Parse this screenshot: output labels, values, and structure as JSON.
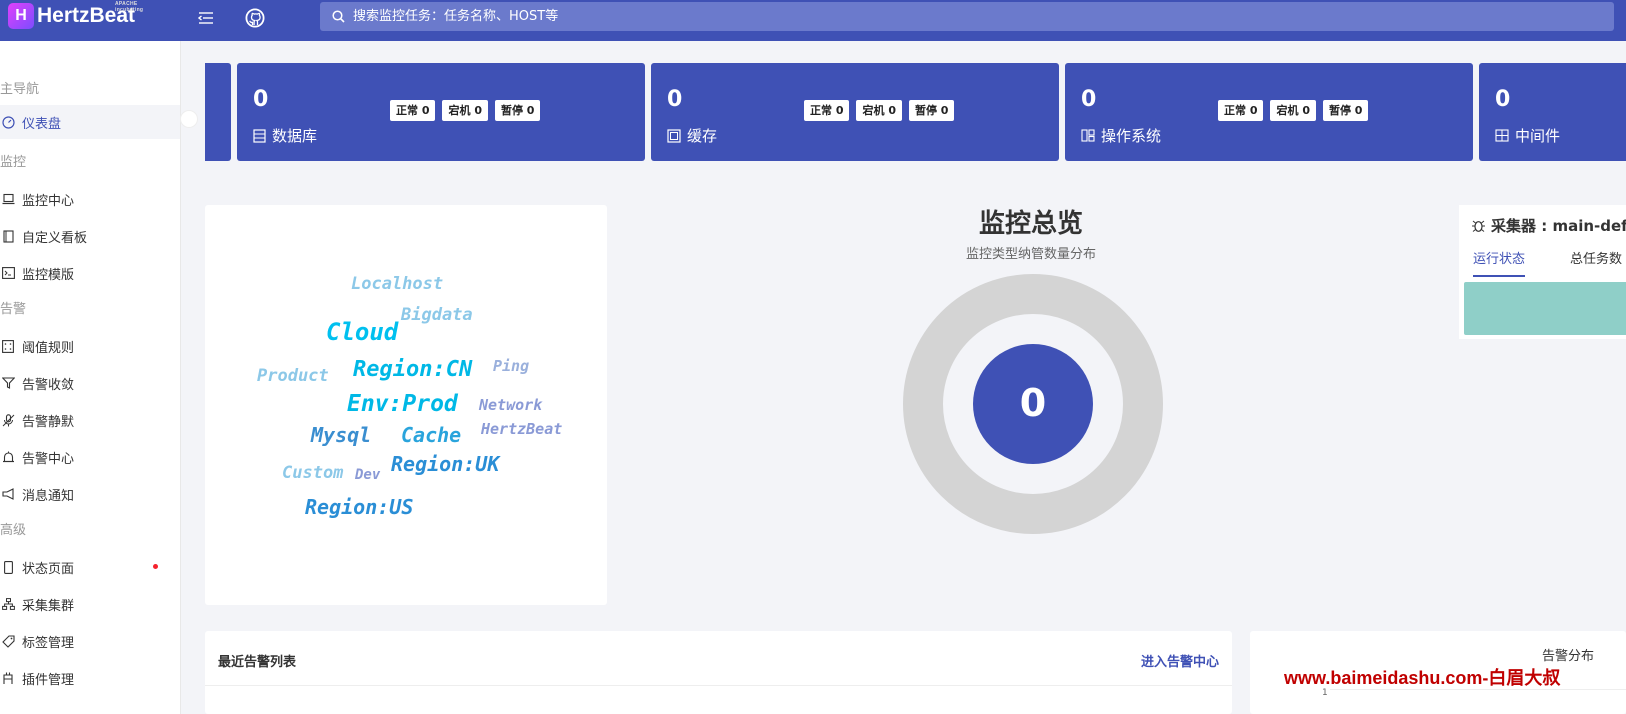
{
  "header": {
    "logo_text": "HertzBeat",
    "logo_small": "APACHE incubating",
    "search_placeholder": "搜索监控任务：任务名称、HOST等"
  },
  "sidebar": {
    "groups": [
      {
        "label": "主导航",
        "items": [
          {
            "label": "仪表盘",
            "icon": "dashboard-icon",
            "active": true
          }
        ]
      },
      {
        "label": "监控",
        "items": [
          {
            "label": "监控中心",
            "icon": "laptop-icon"
          },
          {
            "label": "自定义看板",
            "icon": "book-icon"
          },
          {
            "label": "监控模版",
            "icon": "code-icon"
          }
        ]
      },
      {
        "label": "告警",
        "items": [
          {
            "label": "阈值规则",
            "icon": "calculator-icon"
          },
          {
            "label": "告警收敛",
            "icon": "filter-icon"
          },
          {
            "label": "告警静默",
            "icon": "audio-muted-icon"
          },
          {
            "label": "告警中心",
            "icon": "alert-icon"
          },
          {
            "label": "消息通知",
            "icon": "notification-icon"
          }
        ]
      },
      {
        "label": "高级",
        "items": [
          {
            "label": "状态页面",
            "icon": "mobile-icon",
            "dot": true
          },
          {
            "label": "采集集群",
            "icon": "cluster-icon"
          },
          {
            "label": "标签管理",
            "icon": "tag-icon"
          },
          {
            "label": "插件管理",
            "icon": "plugin-icon"
          }
        ]
      }
    ]
  },
  "cards": [
    {
      "count": "0",
      "name": "数据库",
      "icon": "database-icon",
      "badges": [
        "正常 0",
        "宕机 0",
        "暂停 0"
      ]
    },
    {
      "count": "0",
      "name": "缓存",
      "icon": "cache-icon",
      "badges": [
        "正常 0",
        "宕机 0",
        "暂停 0"
      ]
    },
    {
      "count": "0",
      "name": "操作系统",
      "icon": "os-icon",
      "badges": [
        "正常 0",
        "宕机 0",
        "暂停 0"
      ]
    },
    {
      "count": "0",
      "name": "中间件",
      "icon": "middleware-icon",
      "badges": []
    }
  ],
  "tag_cloud": [
    {
      "text": "Localhost",
      "color": "#8cc8e8"
    },
    {
      "text": "Bigdata",
      "color": "#8cc8e8"
    },
    {
      "text": "Cloud",
      "color": "#00c0ef"
    },
    {
      "text": "Region:CN",
      "color": "#00b8e6"
    },
    {
      "text": "Ping",
      "color": "#9ab0dc"
    },
    {
      "text": "Product",
      "color": "#8cc8e8"
    },
    {
      "text": "Env:Prod",
      "color": "#00b8e6"
    },
    {
      "text": "Network",
      "color": "#8a9ad6"
    },
    {
      "text": "Mysql",
      "color": "#3a8ed0"
    },
    {
      "text": "Cache",
      "color": "#2aa4dc"
    },
    {
      "text": "HertzBeat",
      "color": "#8a9ad6"
    },
    {
      "text": "Region:UK",
      "color": "#2a8ed6"
    },
    {
      "text": "Custom",
      "color": "#8cc8e8"
    },
    {
      "text": "Dev",
      "color": "#8a9ad6"
    },
    {
      "text": "Region:US",
      "color": "#2a8ed6"
    }
  ],
  "overview": {
    "title": "监控总览",
    "subtitle": "监控类型纳管数量分布",
    "total": "0"
  },
  "collector": {
    "title": "采集器 : main-defa",
    "tabs": [
      "运行状态",
      "总任务数"
    ]
  },
  "alarm_list": {
    "title": "最近告警列表",
    "link": "进入告警中心"
  },
  "alarm_dist": {
    "title": "告警分布",
    "axis_tick": "1"
  },
  "watermark": "www.baimeidashu.com-白眉大叔",
  "colors": {
    "primary": "#3f51b5",
    "donut_ring": "#d4d4d4",
    "collector_bar": "#8fcfc8"
  }
}
